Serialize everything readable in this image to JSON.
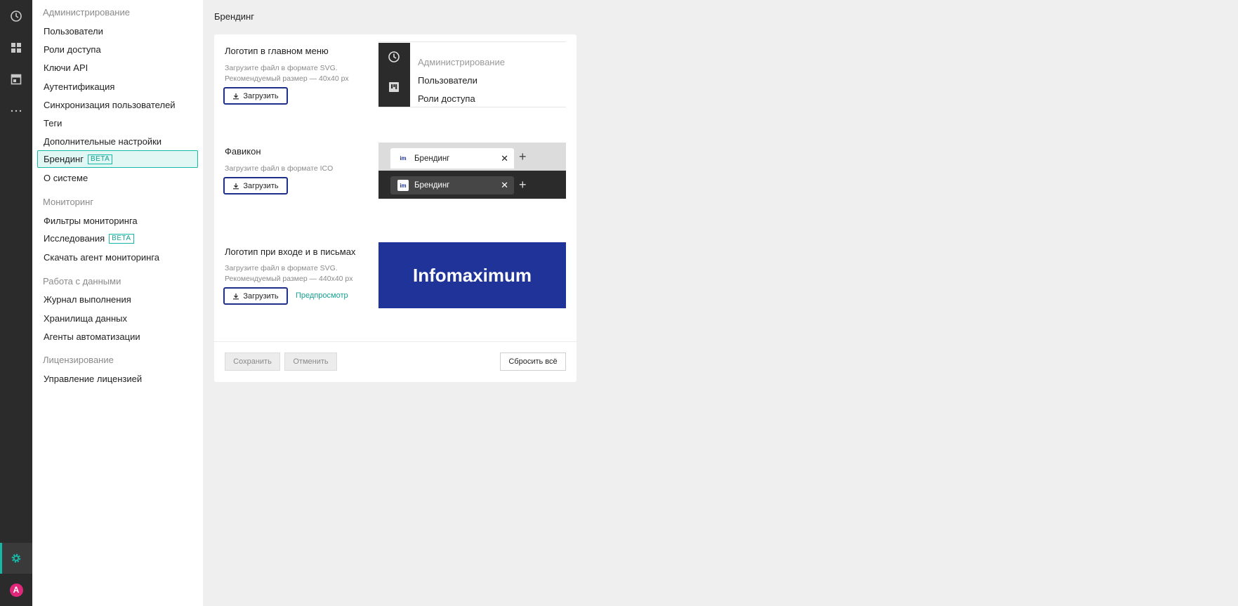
{
  "rail": {
    "icons": [
      "clock-icon",
      "dashboard-icon",
      "store-icon",
      "more-icon",
      "gear-icon"
    ],
    "avatar_letter": "A"
  },
  "sidebar": {
    "admin_title": "Администрирование",
    "admin_items": [
      {
        "label": "Пользователи"
      },
      {
        "label": "Роли доступа"
      },
      {
        "label": "Ключи API"
      },
      {
        "label": "Аутентификация"
      },
      {
        "label": "Синхронизация пользователей"
      },
      {
        "label": "Теги"
      },
      {
        "label": "Дополнительные настройки"
      },
      {
        "label": "Брендинг",
        "badge": "BETA",
        "active": true
      },
      {
        "label": "О системе"
      }
    ],
    "monitoring_title": "Мониторинг",
    "monitoring_items": [
      {
        "label": "Фильтры мониторинга"
      },
      {
        "label": "Исследования",
        "badge": "BETA"
      },
      {
        "label": "Скачать агент мониторинга"
      }
    ],
    "data_title": "Работа с данными",
    "data_items": [
      {
        "label": "Журнал выполнения"
      },
      {
        "label": "Хранилища данных"
      },
      {
        "label": "Агенты автоматизации"
      }
    ],
    "license_title": "Лицензирование",
    "license_items": [
      {
        "label": "Управление лицензией"
      }
    ]
  },
  "page": {
    "title": "Брендинг"
  },
  "sections": {
    "menu_logo": {
      "title": "Логотип в главном меню",
      "desc1": "Загрузите файл в формате SVG.",
      "desc2": "Рекомендуемый размер — 40x40 px",
      "upload": "Загрузить"
    },
    "favicon": {
      "title": "Фавикон",
      "desc1": "Загрузите файл в формате ICO",
      "upload": "Загрузить"
    },
    "login_logo": {
      "title": "Логотип при входе и в письмах",
      "desc1": "Загрузите файл в формате SVG.",
      "desc2": "Рекомендуемый размер — 440x40 px",
      "upload": "Загрузить",
      "preview_link": "Предпросмотр"
    }
  },
  "preview_menu": {
    "section": "Администрирование",
    "item1": "Пользователи",
    "item2": "Роли доступа"
  },
  "preview_tabs": {
    "tab_label": "Брендинг",
    "favicon_text": "im",
    "close": "✕",
    "plus": "+"
  },
  "preview_login": {
    "logo_text": "Infomaximum",
    "bg_color": "#1f3399"
  },
  "footer": {
    "save": "Сохранить",
    "cancel": "Отменить",
    "reset": "Сбросить всё"
  },
  "colors": {
    "accent": "#15b8a6",
    "brand_blue": "#1f3399",
    "rail": "#2b2b2b"
  }
}
